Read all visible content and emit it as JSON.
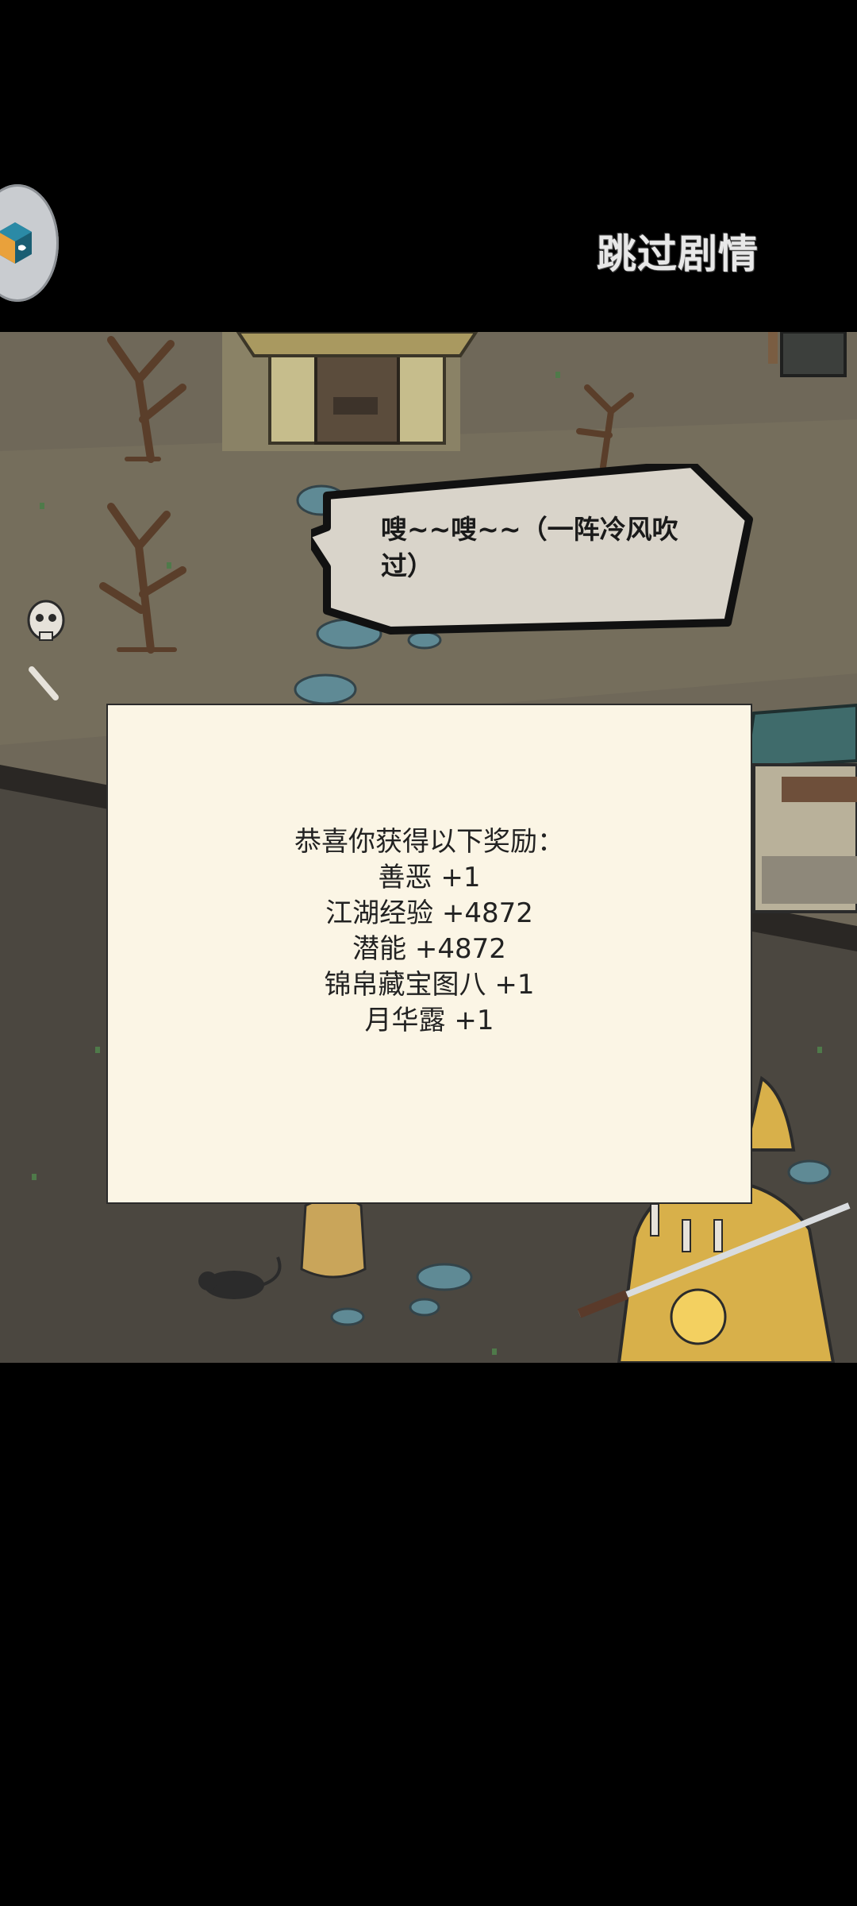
{
  "header": {
    "skip_label": "跳过剧情"
  },
  "speech": {
    "text": "嗖~~嗖~~（一阵冷风吹过）"
  },
  "reward": {
    "title": "恭喜你获得以下奖励：",
    "items": [
      "善恶 +1",
      "江湖经验 +4872",
      "潜能 +4872",
      "锦帛藏宝图八 +1",
      "月华露 +1"
    ]
  },
  "icons": {
    "float_ball": "assistant-cube-icon"
  },
  "colors": {
    "scene_ground": "#6f6859",
    "dialog_bg": "#fbf5e5",
    "speech_bg": "#d9d4ca"
  }
}
